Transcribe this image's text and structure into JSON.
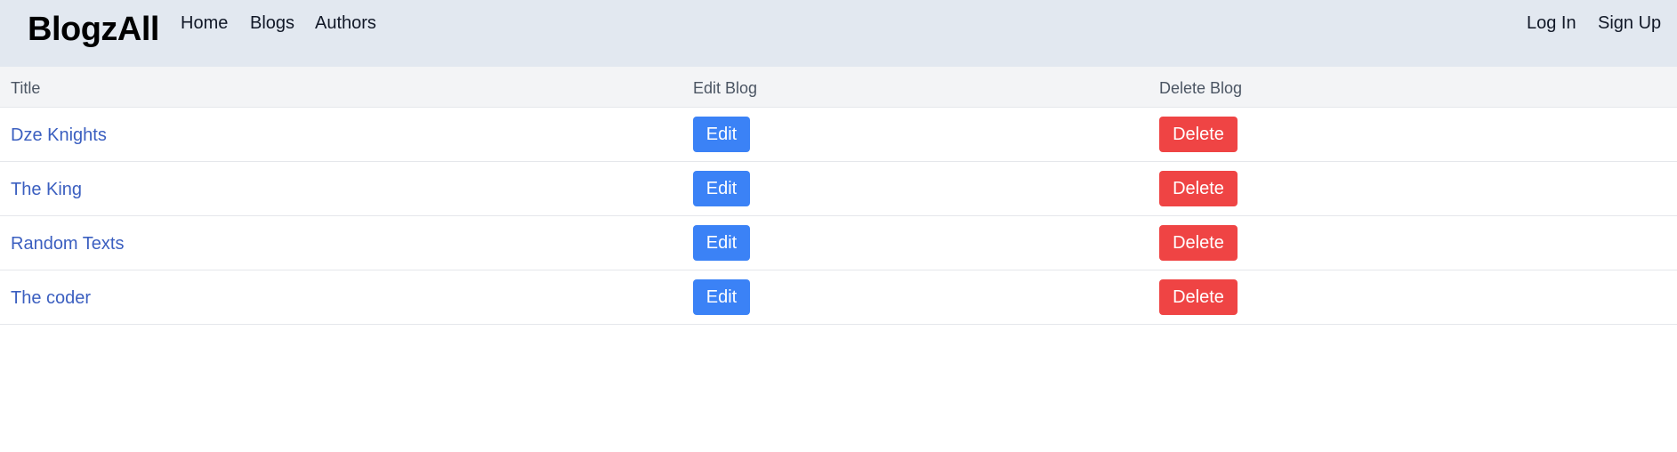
{
  "brand": "BlogzAll",
  "nav": {
    "home": "Home",
    "blogs": "Blogs",
    "authors": "Authors",
    "login": "Log In",
    "signup": "Sign Up"
  },
  "table": {
    "headers": {
      "title": "Title",
      "edit": "Edit Blog",
      "delete": "Delete Blog"
    },
    "rows": [
      {
        "title": "Dze Knights",
        "edit": "Edit",
        "delete": "Delete"
      },
      {
        "title": "The King",
        "edit": "Edit",
        "delete": "Delete"
      },
      {
        "title": "Random Texts",
        "edit": "Edit",
        "delete": "Delete"
      },
      {
        "title": "The coder",
        "edit": "Edit",
        "delete": "Delete"
      }
    ]
  },
  "colors": {
    "navbar_bg": "#e2e8f0",
    "edit_button": "#3b82f6",
    "delete_button": "#ef4444",
    "link": "#3b5fc0"
  }
}
